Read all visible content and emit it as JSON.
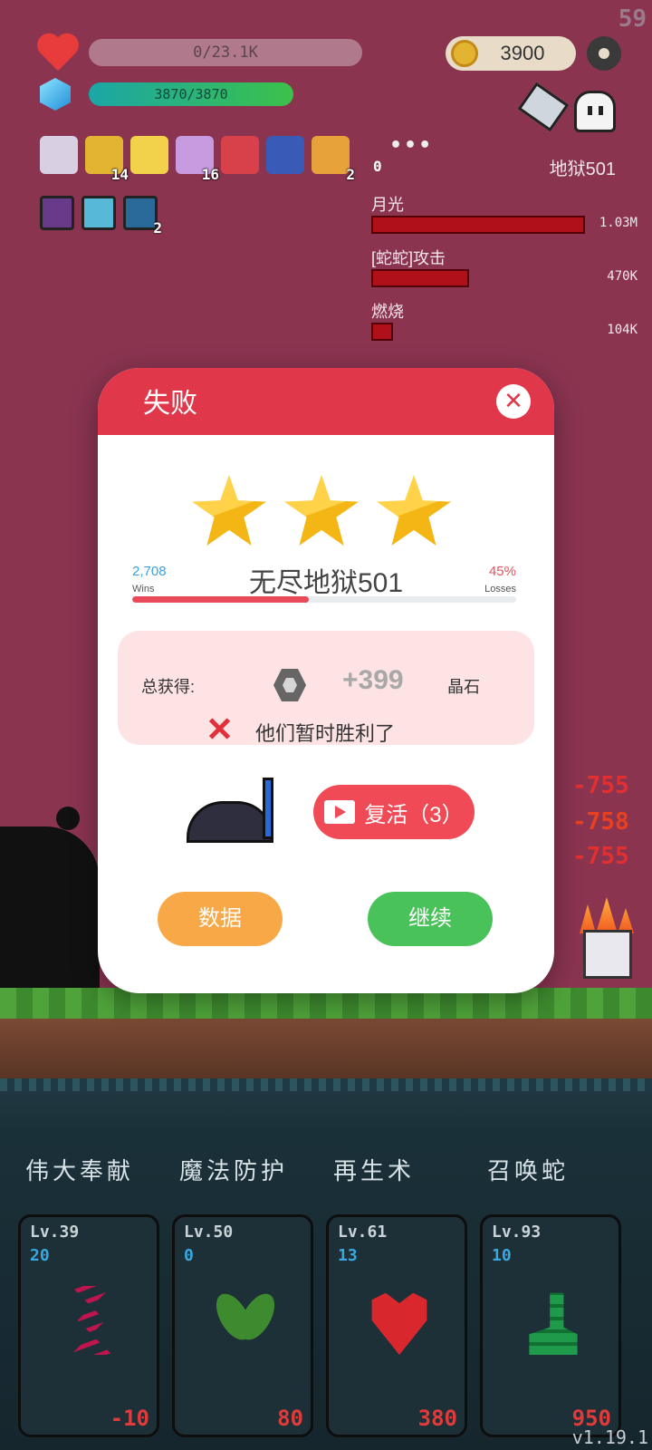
{
  "hud": {
    "fps": "59",
    "hp_text": "0/23.1K",
    "mp_text": "3870/3870",
    "coins": "3900",
    "stage_label": "地狱501",
    "dots": "•••",
    "zero_count": "0",
    "items_row1": [
      {
        "icon": "scroll-icon",
        "count": "",
        "color": "#d8cfe2"
      },
      {
        "icon": "coins-icon",
        "count": "14",
        "color": "#e3b432"
      },
      {
        "icon": "magic-wand-icon",
        "count": "",
        "color": "#f2d24a"
      },
      {
        "icon": "flower-icon",
        "count": "16",
        "color": "#c89ae0"
      },
      {
        "icon": "shield-icon",
        "count": "",
        "color": "#d8404a"
      },
      {
        "icon": "wizard-hat-icon",
        "count": "",
        "color": "#3a5ab8"
      },
      {
        "icon": "briefcase-icon",
        "count": "2",
        "color": "#e8a23a"
      }
    ],
    "items_row2": [
      {
        "icon": "demon-icon",
        "count": "",
        "color": "#6a3a8a"
      },
      {
        "icon": "lightbulb-icon",
        "count": "",
        "color": "#58b8d8"
      },
      {
        "icon": "spiral-icon",
        "count": "2",
        "color": "#2a6a9a"
      }
    ]
  },
  "damage": [
    {
      "name": "月光",
      "value": "1.03M",
      "fraction": 1.0
    },
    {
      "name": "[蛇蛇]攻击",
      "value": "470K",
      "fraction": 0.456
    },
    {
      "name": "燃烧",
      "value": "104K",
      "fraction": 0.101
    }
  ],
  "floating": [
    "-755",
    "-758",
    "-755"
  ],
  "dialog": {
    "title": "失败",
    "close": "✕",
    "stars": 3,
    "wins_value": "2,708",
    "wins_label": "Wins",
    "losses_value": "45%",
    "losses_label": "Losses",
    "stage_name": "无尽地狱501",
    "progress_fraction": 0.46,
    "reward_label": "总获得:",
    "reward_amount": "+399",
    "reward_unit": "晶石",
    "reward_message": "他们暂时胜利了",
    "revive_label": "复活（3）",
    "data_label": "数据",
    "continue_label": "继续"
  },
  "skills": [
    {
      "name": "伟大奉献",
      "level": "Lv.39",
      "count": "20",
      "cost": "-10",
      "icon": "dna-icon"
    },
    {
      "name": "魔法防护",
      "level": "Lv.50",
      "count": "0",
      "cost": "80",
      "icon": "leaf-icon"
    },
    {
      "name": "再生术",
      "level": "Lv.61",
      "count": "13",
      "cost": "380",
      "icon": "winged-heart-icon"
    },
    {
      "name": "召唤蛇",
      "level": "Lv.93",
      "count": "10",
      "cost": "950",
      "icon": "snake-icon"
    }
  ],
  "version": "v1.19.1"
}
